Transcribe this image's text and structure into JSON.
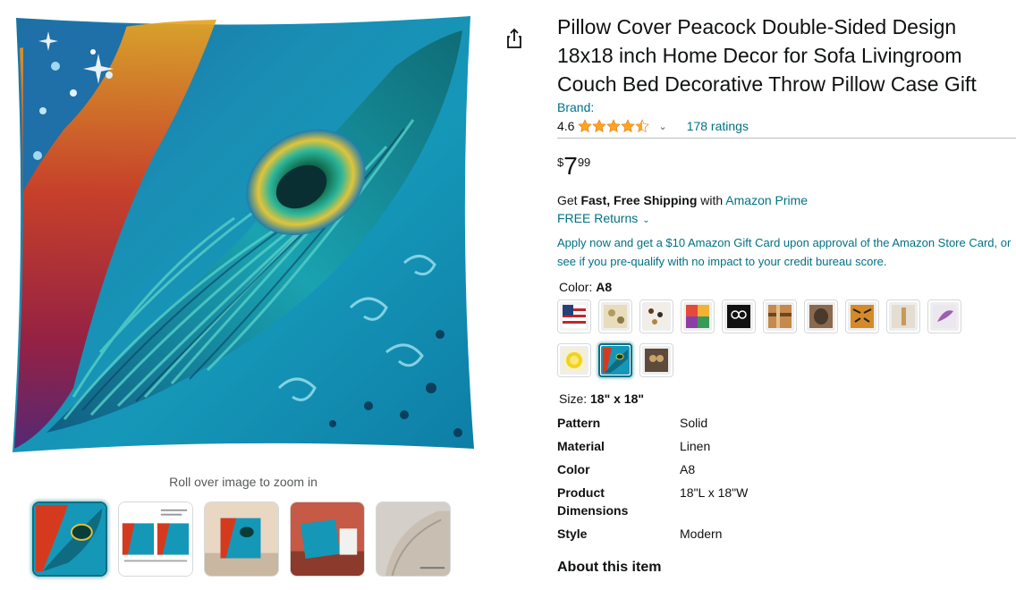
{
  "product": {
    "title": "Pillow Cover Peacock Double-Sided Design 18x18 inch Home Decor for Sofa Livingroom Couch Bed Decorative Throw Pillow Case Gift",
    "brand_label": "Brand:",
    "rating_value": "4.6",
    "rating_stars": 4.5,
    "rating_chevron": "⌄",
    "ratings_count": "178 ratings"
  },
  "price": {
    "symbol": "$",
    "whole": "7",
    "fraction": "99"
  },
  "shipping": {
    "prefix": "Get ",
    "bold": "Fast, Free Shipping",
    "mid": " with ",
    "link": "Amazon Prime",
    "returns": "FREE Returns",
    "returns_chevron": "⌄",
    "promo": "Apply now and get a $10 Amazon Gift Card upon approval of the Amazon Store Card, or see if you pre-qualify with no impact to your credit bureau score."
  },
  "variant": {
    "color_label": "Color: ",
    "color_value": "A8",
    "size_label": "Size: ",
    "size_value": "18\" x 18\"",
    "selected_swatch_index": 11
  },
  "specs": [
    {
      "key": "Pattern",
      "value": "Solid"
    },
    {
      "key": "Material",
      "value": "Linen"
    },
    {
      "key": "Color",
      "value": "A8"
    },
    {
      "key": "Product Dimensions",
      "value": "18\"L x 18\"W"
    },
    {
      "key": "Style",
      "value": "Modern"
    }
  ],
  "gallery": {
    "zoom_hint": "Roll over image to zoom in",
    "selected_thumb_index": 0
  },
  "section": {
    "about": "About this item"
  },
  "colors": {
    "link": "#007185",
    "star": "#ffa41c",
    "text": "#0f1111",
    "muted": "#565959"
  }
}
